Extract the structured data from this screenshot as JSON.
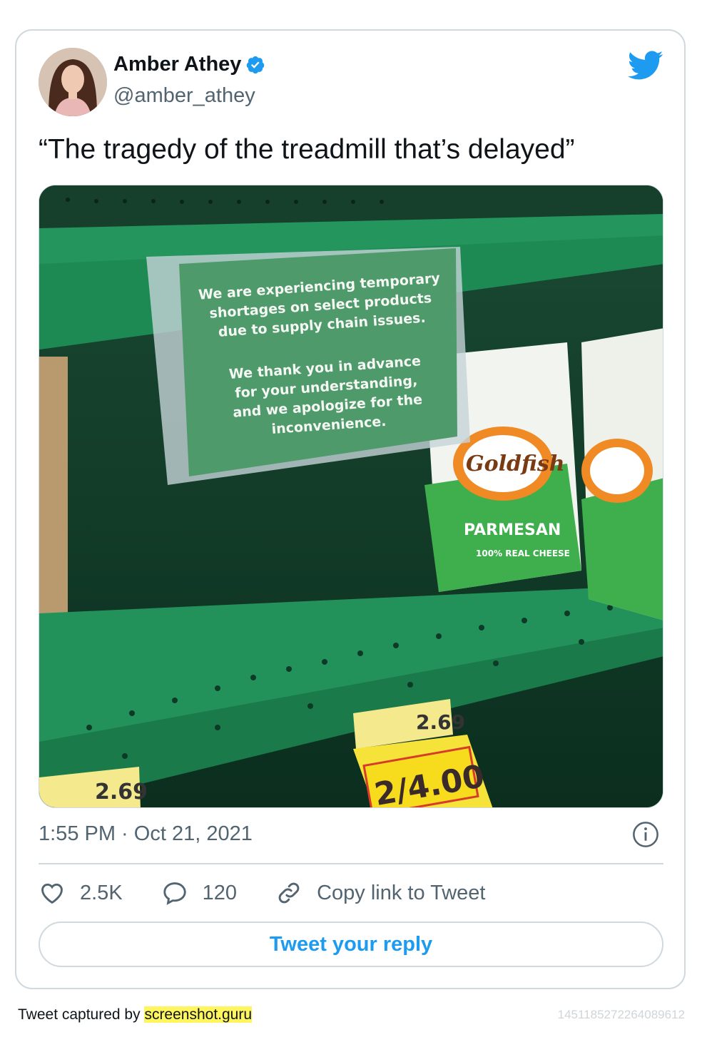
{
  "author": {
    "name": "Amber Athey",
    "handle": "@amber_athey",
    "verified": true
  },
  "tweet": {
    "text": "“The tragedy of the treadmill that’s delayed”",
    "timestamp": "1:55 PM · Oct 21, 2021"
  },
  "photo": {
    "sign_lines_1": [
      "We are experiencing temporary",
      "shortages on select products",
      "due to supply chain issues."
    ],
    "sign_lines_2": [
      "We thank you in advance",
      "for your understanding,",
      "and we apologize for the",
      "inconvenience."
    ],
    "product_brand": "Goldfish",
    "product_flavor": "PARMESAN",
    "product_tag": "100% REAL CHEESE",
    "price_tag_1": "2.69",
    "price_tag_2": "2.69",
    "price_tag_sale": "2/4.00"
  },
  "actions": {
    "likes": "2.5K",
    "replies": "120",
    "copy_link": "Copy link to Tweet"
  },
  "reply_button": "Tweet your reply",
  "footer": {
    "captured_by": "Tweet captured by ",
    "site": "screenshot.guru",
    "tweet_id": "1451185272264089612"
  },
  "colors": {
    "accent": "#1d9bf0",
    "secondary_text": "#536471",
    "border": "#cfd9de",
    "shelf_green": "#1f8a56",
    "highlight": "#fff55e"
  },
  "icons": [
    "verified-badge-icon",
    "twitter-bird-icon",
    "info-icon",
    "heart-icon",
    "comment-icon",
    "link-icon"
  ]
}
